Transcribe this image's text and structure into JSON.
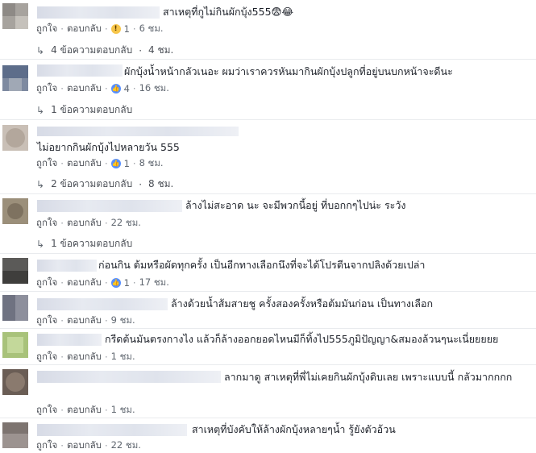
{
  "actions": {
    "like": "ถูกใจ",
    "reply": "ตอบกลับ",
    "sep": "·"
  },
  "comments": [
    {
      "text": "สาเหตุที่กูไม่กินผักบุ้ง555😨😂",
      "reaction": "wow",
      "reaction_count": "1",
      "time": "6 ชม.",
      "replies": "4 ข้อความตอบกลับ",
      "replies_time": "4 ชม."
    },
    {
      "text": "ผักบุ้งน้ำหน้ากลัวเนอะ ผมว่าเราควรหันมากินผักบุ้งปลูกที่อยู่บนบกหน้าจะดีนะ",
      "reaction": "like",
      "reaction_count": "4",
      "time": "16 ชม.",
      "replies": "1 ข้อความตอบกลับ"
    },
    {
      "text": "ไม่อยากกินผักบุ้งไปหลายวัน 555",
      "reaction": "like",
      "reaction_count": "1",
      "time": "8 ชม.",
      "replies": "2 ข้อความตอบกลับ",
      "replies_time": "8 ชม."
    },
    {
      "text": "ล้างไม่สะอาด นะ จะมีพวกนี้อยู่ ที่บอกกๆไปน่ะ ระวัง",
      "time": "22 ชม.",
      "replies": "1 ข้อความตอบกลับ"
    },
    {
      "text": "ก่อนกิน ต้มหรือผัดทุกครั้ง เป็นอีกทางเลือกนึงที่จะได้โปรตีนจากปลิงด้วยเปล่า",
      "reaction": "like",
      "reaction_count": "1",
      "time": "17 ชม."
    },
    {
      "text": "ล้างด้วยน้ำส้มสายชู ครั้งสองครั้งหรือต้มมันก่อน เป็นทางเลือก",
      "time": "9 ชม."
    },
    {
      "text": "กรีดต้นมันตรงกางไง แล้วก็ล้างออกยอดไหนมีก็ทิ้งไป555ภูมิปัญญา&สมองล้วนๆนะเนี่ยยยยย",
      "time": "1 ชม."
    },
    {
      "text": "ลากมาดู สาเหตุที่พี่ไม่เคยกินผักบุ้งดิบเลย เพราะแบบนี้ กลัวมากกกก",
      "time": "1 ชม."
    },
    {
      "text": "สาเหตุที่บังคับให้ล้างผักบุ้งหลายๆน้ำ รู้ยังตัวอ้วน",
      "time": "22 ชม."
    }
  ]
}
